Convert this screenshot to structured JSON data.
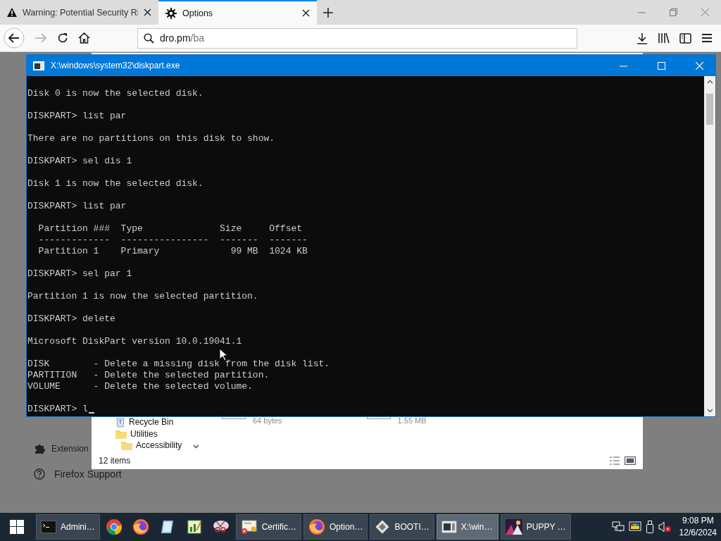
{
  "browser": {
    "tabs": [
      {
        "label": "Warning: Potential Security Ri",
        "selected": false
      },
      {
        "label": "Options",
        "selected": true
      }
    ],
    "address": {
      "host": "dro.pm",
      "path": "/ba"
    }
  },
  "options_page": {
    "items": [
      {
        "label": "Extension"
      },
      {
        "label": "Firefox Support"
      }
    ]
  },
  "explorer": {
    "nav_items": [
      {
        "label": "Recycle Bin"
      },
      {
        "label": "Utilities",
        "children": [
          {
            "label": "Accessibility"
          }
        ]
      }
    ],
    "files": [
      {
        "size": "64 bytes"
      },
      {
        "size": "1.55 MB"
      }
    ],
    "status": "12 items"
  },
  "terminal": {
    "title": "X:\\windows\\system32\\diskpart.exe",
    "blocks": [
      [
        "Disk 0 is now the selected disk."
      ],
      [
        "DISKPART> list par"
      ],
      [
        "There are no partitions on this disk to show."
      ],
      [
        "DISKPART> sel dis 1"
      ],
      [
        "Disk 1 is now the selected disk."
      ],
      [
        "DISKPART> list par"
      ],
      [
        "  Partition ###  Type              Size     Offset",
        "  -------------  ----------------  -------  -------",
        "  Partition 1    Primary             99 MB  1024 KB"
      ],
      [
        "DISKPART> sel par 1"
      ],
      [
        "Partition 1 is now the selected partition."
      ],
      [
        "DISKPART> delete"
      ],
      [
        "Microsoft DiskPart version 10.0.19041.1"
      ],
      [
        "DISK        - Delete a missing disk from the disk list.",
        "PARTITION   - Delete the selected partition.",
        "VOLUME      - Delete the selected volume."
      ],
      [
        "DISKPART> l"
      ]
    ]
  },
  "taskbar": {
    "items": [
      {
        "kind": "window",
        "label": "Admini…",
        "selected": false
      },
      {
        "kind": "pinned"
      },
      {
        "kind": "pinned"
      },
      {
        "kind": "pinned"
      },
      {
        "kind": "pinned"
      },
      {
        "kind": "pinned"
      },
      {
        "kind": "window",
        "label": "Certific…",
        "selected": false
      },
      {
        "kind": "window",
        "label": "Option…",
        "selected": false
      },
      {
        "kind": "window",
        "label": "BOOTI…",
        "selected": false
      },
      {
        "kind": "window",
        "label": "X:\\win…",
        "selected": true
      },
      {
        "kind": "window",
        "label": "PUPPY …",
        "selected": false
      }
    ],
    "clock": {
      "time": "9:08 PM",
      "date": "12/6/2024"
    }
  }
}
